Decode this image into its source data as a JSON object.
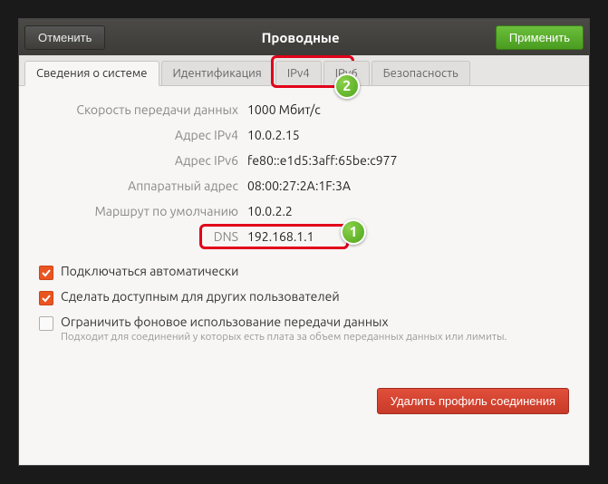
{
  "titlebar": {
    "cancel": "Отменить",
    "title": "Проводные",
    "apply": "Применить"
  },
  "tabs": {
    "details": "Сведения о системе",
    "identity": "Идентификация",
    "ipv4": "IPv4",
    "ipv6": "IPv6",
    "security": "Безопасность"
  },
  "info": {
    "speed_label": "Скорость передачи данных",
    "speed_value": "1000 Мбит/с",
    "ipv4_label": "Адрес IPv4",
    "ipv4_value": "10.0.2.15",
    "ipv6_label": "Адрес IPv6",
    "ipv6_value": "fe80::e1d5:3aff:65be:c977",
    "hw_label": "Аппаратный адрес",
    "hw_value": "08:00:27:2A:1F:3A",
    "route_label": "Маршрут по умолчанию",
    "route_value": "10.0.2.2",
    "dns_label": "DNS",
    "dns_value": "192.168.1.1"
  },
  "checks": {
    "auto_connect": "Подключаться автоматически",
    "all_users": "Сделать доступным для других пользователей",
    "metered": "Ограничить фоновое использование передачи данных",
    "metered_sub": "Подходит для соединений у которых есть плата за объем переданных данных или лимиты."
  },
  "footer": {
    "delete": "Удалить профиль соединения"
  },
  "annotations": {
    "badge1": "1",
    "badge2": "2"
  }
}
